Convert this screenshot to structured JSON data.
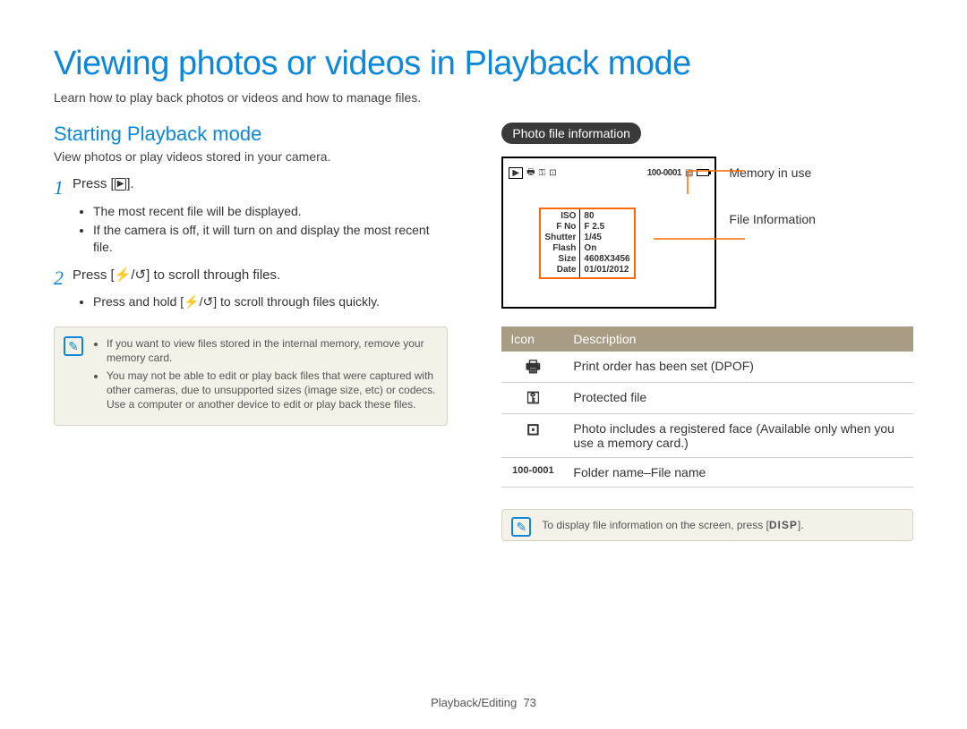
{
  "title": "Viewing photos or videos in Playback mode",
  "intro": "Learn how to play back photos or videos and how to manage files.",
  "left": {
    "heading": "Starting Playback mode",
    "sub": "View photos or play videos stored in your camera.",
    "step1_label": "Press [",
    "step1_label_end": "].",
    "step1_bullets": [
      "The most recent file will be displayed.",
      "If the camera is off, it will turn on and display the most recent file."
    ],
    "step2_label": "Press [",
    "step2_mid": "/",
    "step2_end": "] to scroll through files.",
    "step2_bullets": [
      "Press and hold [⚡/↺] to scroll through files quickly."
    ],
    "note_items": [
      "If you want to view files stored in the internal memory, remove your memory card.",
      "You may not be able to edit or play back files that were captured with other cameras, due to unsupported sizes (image size, etc) or codecs. Use a computer or another device to edit or play back these files."
    ]
  },
  "right": {
    "pill": "Photo file information",
    "callout_mem": "Memory in use",
    "callout_info": "File Information",
    "cam_file": "100-0001",
    "info_rows": [
      {
        "k": "ISO",
        "v": "80"
      },
      {
        "k": "F No",
        "v": "F 2.5"
      },
      {
        "k": "Shutter",
        "v": "1/45"
      },
      {
        "k": "Flash",
        "v": "On"
      },
      {
        "k": "Size",
        "v": "4608X3456"
      },
      {
        "k": "Date",
        "v": "01/01/2012"
      }
    ],
    "table_head_icon": "Icon",
    "table_head_desc": "Description",
    "rows": [
      {
        "icon": "print-icon",
        "glyph": "🖶",
        "desc": "Print order has been set (DPOF)"
      },
      {
        "icon": "key-icon",
        "glyph": "⚿",
        "desc": "Protected file"
      },
      {
        "icon": "face-icon",
        "glyph": "⊡",
        "desc": "Photo includes a registered face (Available only when you use a memory card.)"
      },
      {
        "icon": "filecode-icon",
        "glyph": "100-0001",
        "desc": "Folder name–File name"
      }
    ],
    "note2_pre": "To display file information on the screen, press [",
    "note2_disp": "DISP",
    "note2_post": "]."
  },
  "footer_section": "Playback/Editing",
  "footer_page": "73"
}
